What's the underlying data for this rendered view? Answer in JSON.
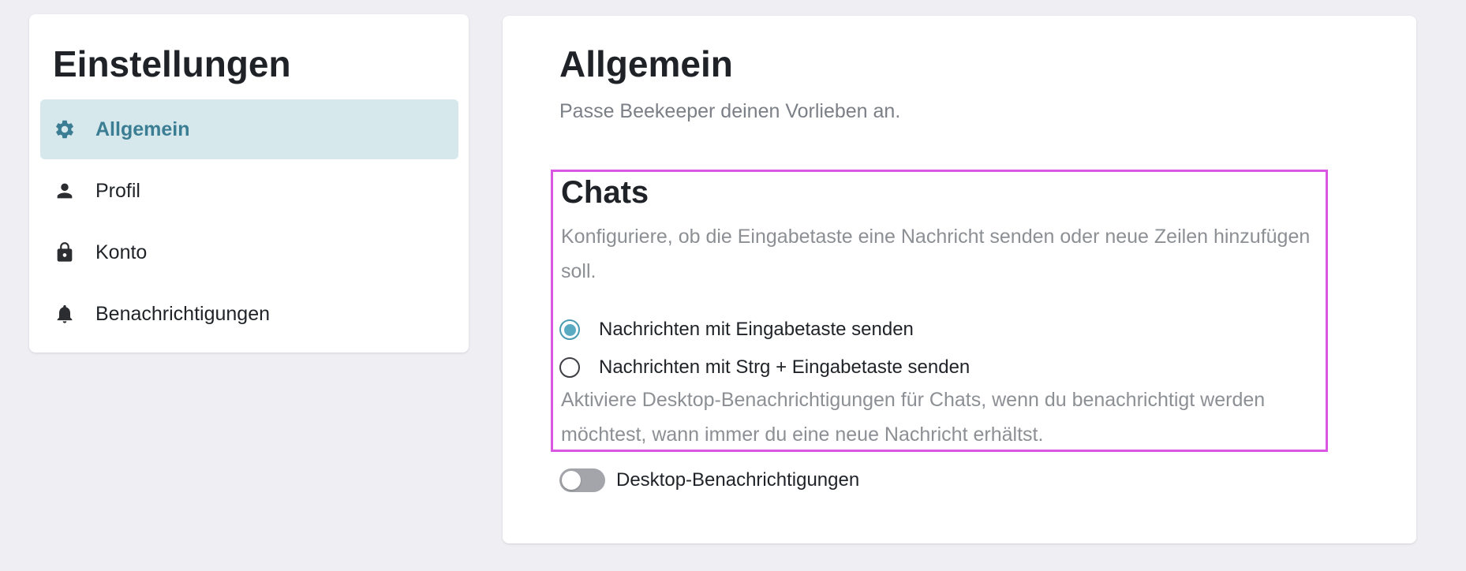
{
  "sidebar": {
    "title": "Einstellungen",
    "items": [
      {
        "label": "Allgemein",
        "icon": "gear-icon",
        "active": true
      },
      {
        "label": "Profil",
        "icon": "person-icon",
        "active": false
      },
      {
        "label": "Konto",
        "icon": "lock-icon",
        "active": false
      },
      {
        "label": "Benachrichtigungen",
        "icon": "bell-icon",
        "active": false
      }
    ]
  },
  "main": {
    "title": "Allgemein",
    "subtitle": "Passe Beekeeper deinen Vorlieben an.",
    "chats": {
      "title": "Chats",
      "enter_description": "Konfiguriere, ob die Eingabetaste eine Nachricht senden oder neue Zeilen hinzufügen soll.",
      "options": [
        {
          "label": "Nachrichten mit Eingabetaste senden",
          "selected": true
        },
        {
          "label": "Nachrichten mit Strg + Eingabetaste senden",
          "selected": false
        }
      ],
      "notification_description": "Aktiviere Desktop-Benachrichtigungen für Chats, wenn du benachrichtigt werden möchtest, wann immer du eine neue Nachricht erhältst."
    },
    "desktop_notifications": {
      "label": "Desktop-Benachrichtigungen",
      "enabled": false
    }
  },
  "colors": {
    "background": "#efeef3",
    "active_item_bg": "#d6e8ec",
    "accent": "#3b7d93",
    "radio_selected": "#5aaac2",
    "highlight_border": "#d957e3",
    "toggle_off": "#a3a5aa"
  }
}
